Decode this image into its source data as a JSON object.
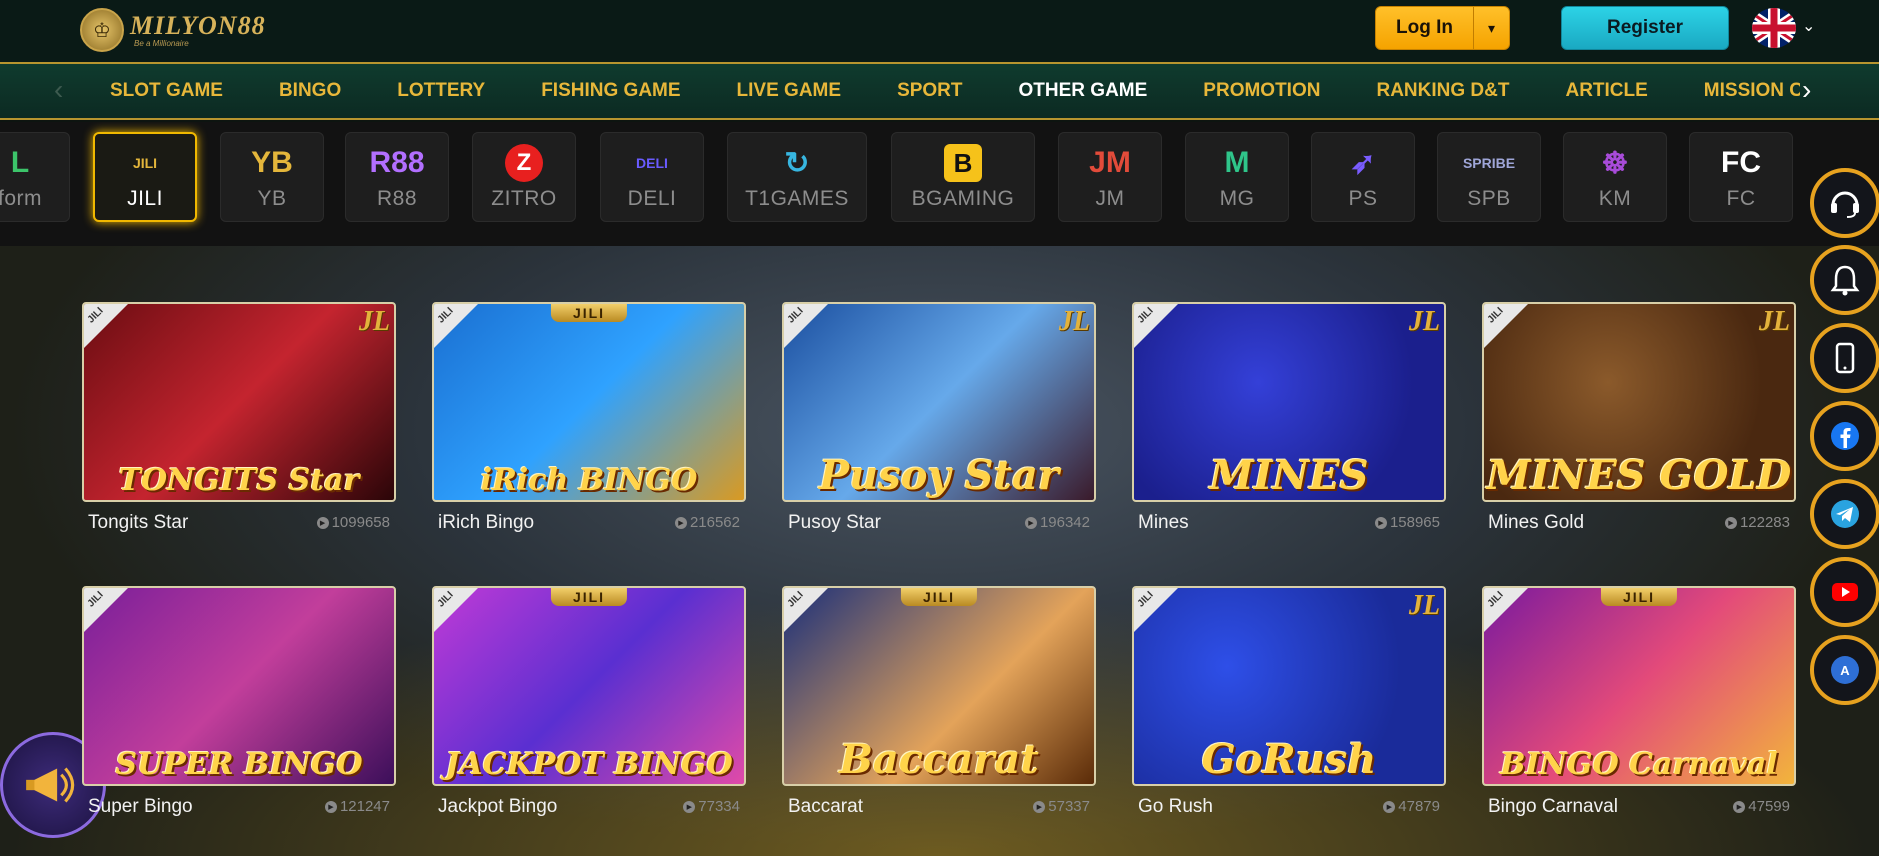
{
  "header": {
    "logo_text": "MILYON88",
    "logo_tagline": "Be a Millionaire",
    "login_label": "Log In",
    "register_label": "Register",
    "language": "English (UK flag)"
  },
  "nav": {
    "items": [
      {
        "label": "SLOT GAME",
        "active": false
      },
      {
        "label": "BINGO",
        "active": false
      },
      {
        "label": "LOTTERY",
        "active": false
      },
      {
        "label": "FISHING GAME",
        "active": false
      },
      {
        "label": "LIVE GAME",
        "active": false
      },
      {
        "label": "SPORT",
        "active": false
      },
      {
        "label": "OTHER GAME",
        "active": true
      },
      {
        "label": "PROMOTION",
        "active": false
      },
      {
        "label": "RANKING D&T",
        "active": false
      },
      {
        "label": "ARTICLE",
        "active": false
      },
      {
        "label": "MISSION CEN",
        "active": false
      }
    ]
  },
  "providers": {
    "items": [
      {
        "label": "form",
        "logo": "L",
        "color": "#3cc46a",
        "active": false
      },
      {
        "label": "JILI",
        "logo": "JILI",
        "color": "#e4b63b",
        "active": true
      },
      {
        "label": "YB",
        "logo": "YB",
        "color": "#e4b63b",
        "active": false
      },
      {
        "label": "R88",
        "logo": "R88",
        "color": "#b26fff",
        "active": false
      },
      {
        "label": "ZITRO",
        "logo": "Z",
        "color": "#e8201f",
        "active": false
      },
      {
        "label": "DELI",
        "logo": "DELI",
        "color": "#6a5bff",
        "active": false
      },
      {
        "label": "T1GAMES",
        "logo": "↻",
        "color": "#37b6e0",
        "active": false
      },
      {
        "label": "BGAMING",
        "logo": "B",
        "color": "#f6c21a",
        "active": false
      },
      {
        "label": "JM",
        "logo": "JM",
        "color": "#e24b3a",
        "active": false
      },
      {
        "label": "MG",
        "logo": "M",
        "color": "#2fc58a",
        "active": false
      },
      {
        "label": "PS",
        "logo": "➶",
        "color": "#7a5cff",
        "active": false
      },
      {
        "label": "SPB",
        "logo": "SPRIBE",
        "color": "#9fa6d8",
        "active": false
      },
      {
        "label": "KM",
        "logo": "☸",
        "color": "#a84bd9",
        "active": false
      },
      {
        "label": "FC",
        "logo": "FC",
        "color": "#ffffff",
        "active": false
      }
    ]
  },
  "games": [
    {
      "name": "Tongits Star",
      "count": "1099658",
      "tag": "JILI",
      "badge": "JL",
      "title": "TONGITS Star",
      "bg": "linear-gradient(135deg,#6b0d12,#c4242f 50%,#2a0508)"
    },
    {
      "name": "iRich Bingo",
      "count": "216562",
      "tag": "JILI",
      "badge": "JILI",
      "title": "iRich BINGO",
      "bg": "linear-gradient(135deg,#1a6fd1,#2fa2ff 50%,#d99a22)"
    },
    {
      "name": "Pusoy Star",
      "count": "196342",
      "tag": "JILI",
      "badge": "JL",
      "title": "Pusoy Star",
      "bg": "linear-gradient(135deg,#1b4fa0,#66a9ea 50%,#3a1a2a)"
    },
    {
      "name": "Mines",
      "count": "158965",
      "tag": "JILI",
      "badge": "JL",
      "title": "MINES",
      "bg": "radial-gradient(circle at 40% 40%,#3440d8,#1b1f8d 70%)"
    },
    {
      "name": "Mines Gold",
      "count": "122283",
      "tag": "JILI",
      "badge": "JL",
      "title": "MINES GOLD",
      "bg": "radial-gradient(circle at 40% 40%,#8b5a2b,#4a2810 70%)"
    },
    {
      "name": "Super Bingo",
      "count": "121247",
      "tag": "JILI",
      "badge": "",
      "title": "SUPER BINGO",
      "bg": "linear-gradient(135deg,#7a1f9a,#c23e9b 50%,#3c0f5a)"
    },
    {
      "name": "Jackpot Bingo",
      "count": "77334",
      "tag": "JILI",
      "badge": "JILI",
      "title": "JACKPOT BINGO",
      "bg": "linear-gradient(135deg,#c03ad6,#5a2fd1 50%,#e04aa8)"
    },
    {
      "name": "Baccarat",
      "count": "57337",
      "tag": "JILI",
      "badge": "JILI",
      "title": "Baccarat",
      "bg": "linear-gradient(135deg,#1a2f7a,#e3a35a 60%,#5a2b08)"
    },
    {
      "name": "Go Rush",
      "count": "47879",
      "tag": "JILI",
      "badge": "JL",
      "title": "GoRush",
      "bg": "radial-gradient(circle at 30% 40%,#2e4fe8,#1a2b9a 70%)"
    },
    {
      "name": "Bingo Carnaval",
      "count": "47599",
      "tag": "JILI",
      "badge": "JILI",
      "title": "BINGO Carnaval",
      "bg": "linear-gradient(135deg,#7a1a9e,#e34a7a 50%,#f2b43c)"
    }
  ],
  "side_buttons": [
    "headset-icon",
    "bell-icon",
    "mobile-icon",
    "facebook-icon",
    "telegram-icon",
    "youtube-icon",
    "app-icon"
  ],
  "colors": {
    "accent_gold": "#e7b73a",
    "login_orange": "#f5a300",
    "register_cyan": "#1aa9c2"
  }
}
